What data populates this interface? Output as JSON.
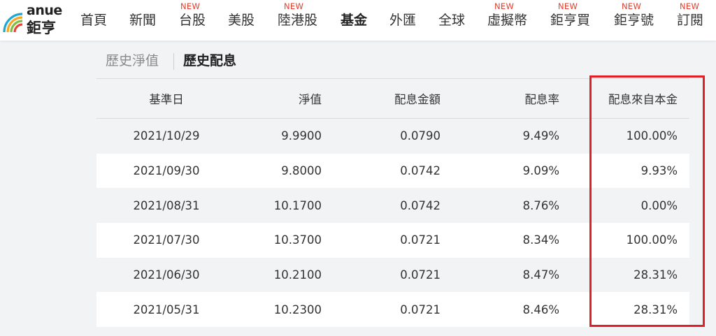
{
  "brand": {
    "en": "anue",
    "zh": "鉅亨"
  },
  "nav": {
    "items": [
      {
        "label": "首頁",
        "badge": ""
      },
      {
        "label": "新聞",
        "badge": ""
      },
      {
        "label": "台股",
        "badge": "NEW"
      },
      {
        "label": "美股",
        "badge": ""
      },
      {
        "label": "陸港股",
        "badge": "NEW"
      },
      {
        "label": "基金",
        "badge": "",
        "active": true
      },
      {
        "label": "外匯",
        "badge": ""
      },
      {
        "label": "全球",
        "badge": ""
      },
      {
        "label": "虛擬幣",
        "badge": "NEW"
      },
      {
        "label": "鉅亨買",
        "badge": "NEW"
      },
      {
        "label": "鉅亨號",
        "badge": "NEW"
      },
      {
        "label": "訂閱",
        "badge": "NEW"
      }
    ]
  },
  "subtabs": {
    "nav_history": "歷史淨值",
    "dividend_history": "歷史配息"
  },
  "table": {
    "headers": {
      "date": "基準日",
      "nav": "淨值",
      "amount": "配息金額",
      "rate": "配息率",
      "capital": "配息來自本金"
    },
    "rows": [
      {
        "date": "2021/10/29",
        "nav": "9.9900",
        "amount": "0.0790",
        "rate": "9.49%",
        "capital": "100.00%"
      },
      {
        "date": "2021/09/30",
        "nav": "9.8000",
        "amount": "0.0742",
        "rate": "9.09%",
        "capital": "9.93%"
      },
      {
        "date": "2021/08/31",
        "nav": "10.1700",
        "amount": "0.0742",
        "rate": "8.76%",
        "capital": "0.00%"
      },
      {
        "date": "2021/07/30",
        "nav": "10.3700",
        "amount": "0.0721",
        "rate": "8.34%",
        "capital": "100.00%"
      },
      {
        "date": "2021/06/30",
        "nav": "10.2100",
        "amount": "0.0721",
        "rate": "8.47%",
        "capital": "28.31%"
      },
      {
        "date": "2021/05/31",
        "nav": "10.2300",
        "amount": "0.0721",
        "rate": "8.46%",
        "capital": "28.31%"
      }
    ]
  },
  "colors": {
    "badge": "#e03e2d",
    "highlight_box": "#e41e26",
    "logo_arcs": [
      "#1aa9d6",
      "#f5a623",
      "#7cc043",
      "#e8443a"
    ]
  }
}
